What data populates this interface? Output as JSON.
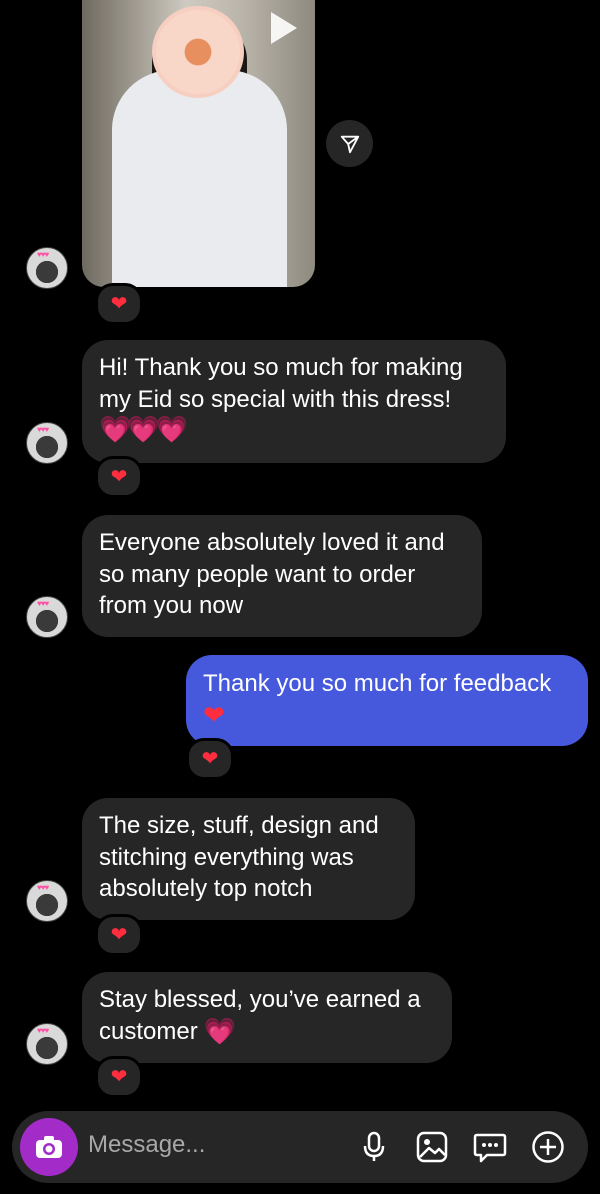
{
  "media_message": {
    "icons": {
      "play": "play-icon",
      "share": "share-icon"
    },
    "reaction": "❤"
  },
  "messages": [
    {
      "id": "m1",
      "sender": "other",
      "lines": [
        "Hi! Thank you so much for making",
        "my Eid so special with this dress!"
      ],
      "emoji": "💗💗💗",
      "reaction": "❤"
    },
    {
      "id": "m2",
      "sender": "other",
      "lines": [
        "Everyone absolutely loved it and",
        "so many people want to order",
        "from you now"
      ],
      "reaction": ""
    },
    {
      "id": "m3",
      "sender": "me",
      "lines": [
        "Thank you so much for feedback"
      ],
      "emoji": "❤",
      "reaction": "❤"
    },
    {
      "id": "m4",
      "sender": "other",
      "lines": [
        "The size, stuff, design and",
        "stitching everything was",
        "absolutely top notch"
      ],
      "reaction": "❤"
    },
    {
      "id": "m5",
      "sender": "other",
      "lines": [
        "Stay blessed, you’ve earned a",
        "customer"
      ],
      "emoji": "💗",
      "reaction": "❤"
    }
  ],
  "composer": {
    "placeholder": "Message...",
    "icons": [
      "camera-icon",
      "microphone-icon",
      "gallery-icon",
      "sticker-icon",
      "plus-icon"
    ]
  },
  "colors": {
    "background": "#000000",
    "bubble_other": "#262626",
    "bubble_me": "#4659dc",
    "camera_button": "#a32cc8"
  }
}
